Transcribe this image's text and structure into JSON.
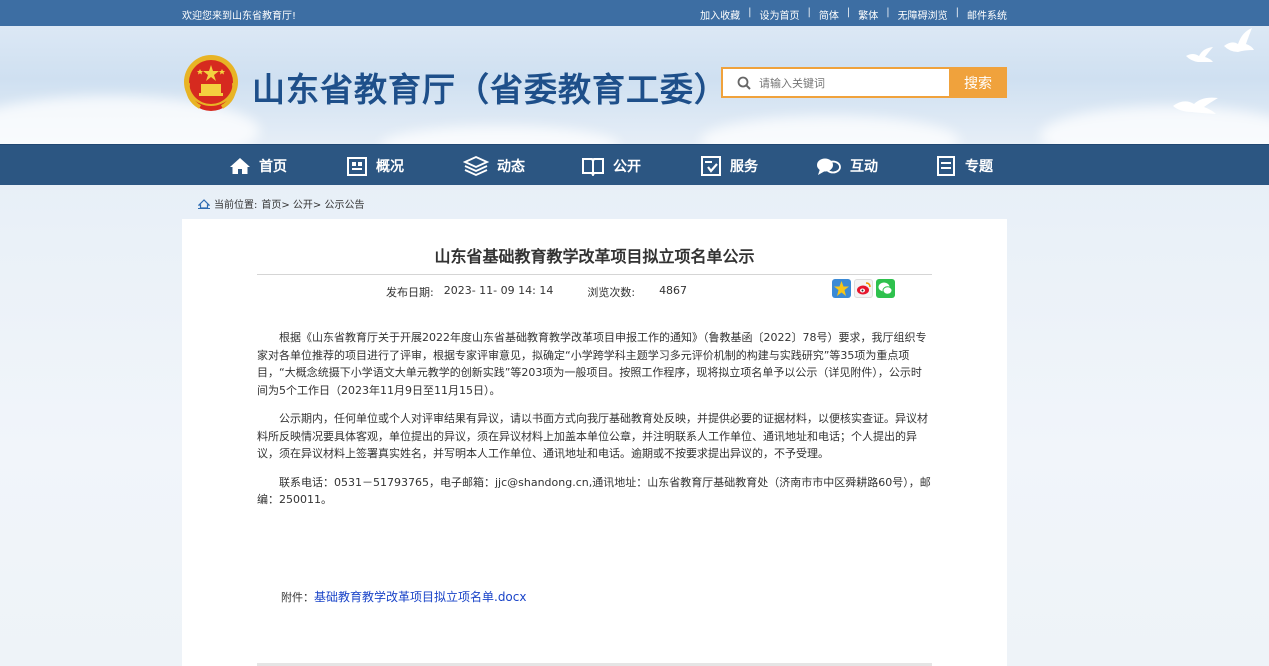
{
  "topbar": {
    "welcome": "欢迎您来到山东省教育厅!",
    "links": [
      "加入收藏",
      "设为首页",
      "简体",
      "繁体",
      "无障碍浏览",
      "邮件系统"
    ],
    "separator": "|"
  },
  "header": {
    "title": "山东省教育厅（省委教育工委）",
    "search_placeholder": "请输入关键词",
    "search_button": "搜索"
  },
  "nav": {
    "items": [
      {
        "label": "首页",
        "icon": "home-icon"
      },
      {
        "label": "概况",
        "icon": "building-icon"
      },
      {
        "label": "动态",
        "icon": "layers-icon"
      },
      {
        "label": "公开",
        "icon": "book-icon"
      },
      {
        "label": "服务",
        "icon": "service-icon"
      },
      {
        "label": "互动",
        "icon": "chat-icon"
      },
      {
        "label": "专题",
        "icon": "document-icon"
      }
    ]
  },
  "breadcrumb": {
    "prefix": "当前位置:",
    "trail": "首页> 公开> 公示公告"
  },
  "article": {
    "title": "山东省基础教育教学改革项目拟立项名单公示",
    "date_label": "发布日期:",
    "date_value": "2023- 11- 09 14: 14",
    "views_label": "浏览次数:",
    "views_value": "4867",
    "paragraphs": [
      "根据《山东省教育厅关于开展2022年度山东省基础教育教学改革项目申报工作的通知》（鲁教基函〔2022〕78号）要求，我厅组织专家对各单位推荐的项目进行了评审，根据专家评审意见，拟确定“小学跨学科主题学习多元评价机制的构建与实践研究”等35项为重点项目，“大概念统摄下小学语文大单元教学的创新实践”等203项为一般项目。按照工作程序，现将拟立项名单予以公示（详见附件），公示时间为5个工作日（2023年11月9日至11月15日）。",
      "公示期内，任何单位或个人对评审结果有异议，请以书面方式向我厅基础教育处反映，并提供必要的证据材料，以便核实查证。异议材料所反映情况要具体客观，单位提出的异议，须在异议材料上加盖本单位公章，并注明联系人工作单位、通讯地址和电话；个人提出的异议，须在异议材料上签署真实姓名，并写明本人工作单位、通讯地址和电话。逾期或不按要求提出异议的，不予受理。",
      "联系电话：0531－51793765，电子邮箱：jjc@shandong.cn,通讯地址：山东省教育厅基础教育处（济南市市中区舜耕路60号），邮编：250011。"
    ],
    "attachment_label": "附件：",
    "attachment_name": "基础教育教学改革项目拟立项名单.docx"
  },
  "colors": {
    "topbar": "#3d6ea3",
    "nav": "#2c5682",
    "title": "#1e4f8a",
    "accent": "#f0a23c",
    "link": "#1a44c8"
  }
}
